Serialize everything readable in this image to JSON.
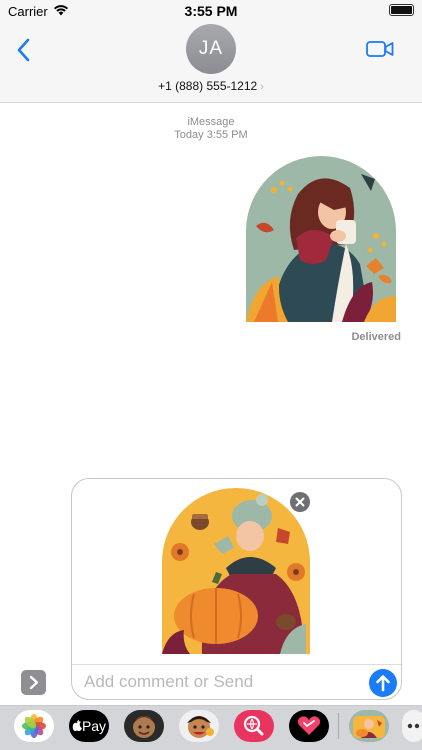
{
  "status": {
    "carrier": "Carrier",
    "time": "3:55 PM"
  },
  "contact": {
    "initials": "JA",
    "phone": "+1 (888) 555-1212",
    "chevron": "›"
  },
  "thread": {
    "service": "iMessage",
    "timestamp_day": "Today",
    "timestamp_time": "3:55 PM",
    "delivery_status": "Delivered"
  },
  "composer": {
    "placeholder": "Add comment or Send"
  },
  "app_strip": {
    "apple_pay_label": "Pay"
  },
  "colors": {
    "accent": "#1a7cf6",
    "header_bg": "#f6f6f6",
    "strip_bg": "#d4d5d9"
  }
}
